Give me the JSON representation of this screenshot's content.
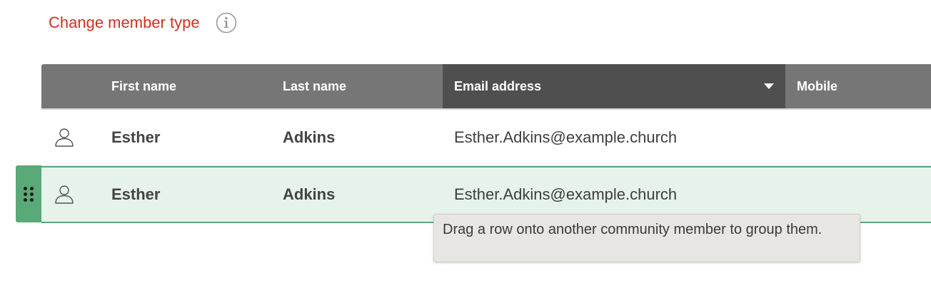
{
  "header": {
    "title": "Change member type",
    "info_icon": "info-circle-icon"
  },
  "table": {
    "columns": [
      {
        "label": "First name"
      },
      {
        "label": "Last name"
      },
      {
        "label": "Email address",
        "sorted": "descending"
      },
      {
        "label": "Mobile"
      }
    ],
    "rows": [
      {
        "icon": "person-icon",
        "first_name": "Esther",
        "last_name": "Adkins",
        "email": "Esther.Adkins@example.church",
        "mobile": "",
        "selected": false
      },
      {
        "icon": "person-icon",
        "first_name": "Esther",
        "last_name": "Adkins",
        "email": "Esther.Adkins@example.church",
        "mobile": "",
        "selected": true
      }
    ]
  },
  "drag_handle": {
    "icon": "drag-handle-icon"
  },
  "tooltip": {
    "text": "Drag a row onto another community member to group them."
  },
  "colors": {
    "title": "#d0301f",
    "header_bg": "#767676",
    "header_sorted_bg": "#4f4f4f",
    "selected_row_bg": "#e5f3eb",
    "accent_green": "#5aa978",
    "tooltip_bg": "#e8e6e3"
  }
}
